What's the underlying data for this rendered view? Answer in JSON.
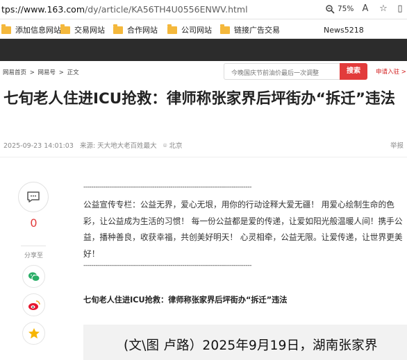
{
  "browser": {
    "url_prefix": "tps://",
    "url_host": "www.163.com",
    "url_path": "/dy/article/KA56TH4U0556ENWV.html",
    "zoom": "75%"
  },
  "bookmarks": [
    {
      "label": "添加信息网站"
    },
    {
      "label": "交易网站"
    },
    {
      "label": "合作网站"
    },
    {
      "label": "公司网站"
    },
    {
      "label": "链接广告交易"
    },
    {
      "label": "News5218"
    }
  ],
  "breadcrumb": [
    "网易首页",
    ">",
    "网易号",
    ">",
    "正文"
  ],
  "search": {
    "placeholder": "今晚国庆节前油价最后一次调整",
    "button": "搜索"
  },
  "enter_link": "申请入驻 >",
  "article": {
    "title": "七旬老人住进ICU抢救：律师称张家界后坪街办“拆迁”违法",
    "date": "2025-09-23 14:01:03",
    "source": "来源: 天大地大老百姓最大",
    "location": "北京",
    "report": "举报",
    "dash_line": "-------------------------------------------------------------------------------------",
    "promo": "公益宣传专栏：公益无界，爱心无垠，用你的行动诠释大爱无疆！ 用爱心绘制生命的色彩，让公益成为生活的习惯！ 每一份公益都是爱的传递，让爱如阳光般温暖人间！携手公益，播种善良，收获幸福，共创美好明天！ 心灵相牵，公益无限。让爱传递，让世界更美好！",
    "subhead": "七旬老人住进ICU抢救：律师称张家界后坪街办“拆迁”违法",
    "image_caption": "(文\\图 卢路）2025年9月19日，湖南张家界"
  },
  "sidebar": {
    "comment_count": "0",
    "share_label": "分享至"
  },
  "colors": {
    "accent_red": "#e23b3b",
    "folder_yellow": "#f4b83c",
    "header_dark": "#2c2c2c"
  }
}
